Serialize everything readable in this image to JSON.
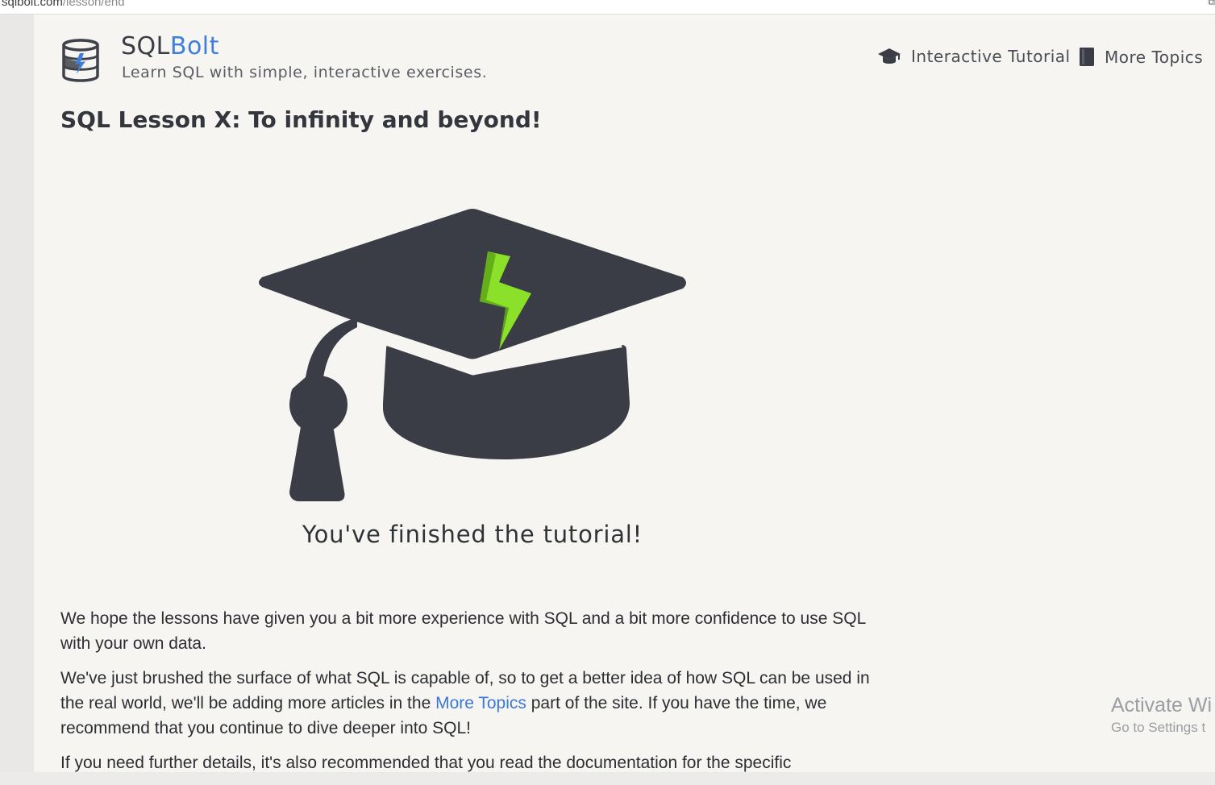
{
  "browser": {
    "url_host": "sqlbolt.com",
    "url_path": "/lesson/end"
  },
  "header": {
    "site_name_plain": "SQL",
    "site_name_accent": "Bolt",
    "tagline": "Learn SQL with simple, interactive exercises.",
    "nav": [
      {
        "label": "Interactive Tutorial",
        "icon": "graduation-cap-icon"
      },
      {
        "label": "More Topics",
        "icon": "book-icon"
      }
    ]
  },
  "lesson": {
    "title": "SQL Lesson X: To infinity and beyond!",
    "finished_caption": "You've finished the tutorial!"
  },
  "body": {
    "p1": "We hope the lessons have given you a bit more experience with SQL and a bit more confidence to use SQL with your own data.",
    "p2_before_link": "We've just brushed the surface of what SQL is capable of, so to get a better idea of how SQL can be used in the real world, we'll be adding more articles in the ",
    "p2_link": "More Topics",
    "p2_after_link": " part of the site. If you have the time, we recommend that you continue to dive deeper into SQL!",
    "p3": "If you need further details, it's also recommended that you read the documentation for the specific"
  },
  "watermark": {
    "line1": "Activate Wi",
    "line2": "Go to Settings t"
  },
  "colors": {
    "page_bg": "#f6f5f2",
    "accent": "#3d7fd9",
    "cap_dark": "#3a3c46",
    "bolt_green": "#8be02a"
  }
}
